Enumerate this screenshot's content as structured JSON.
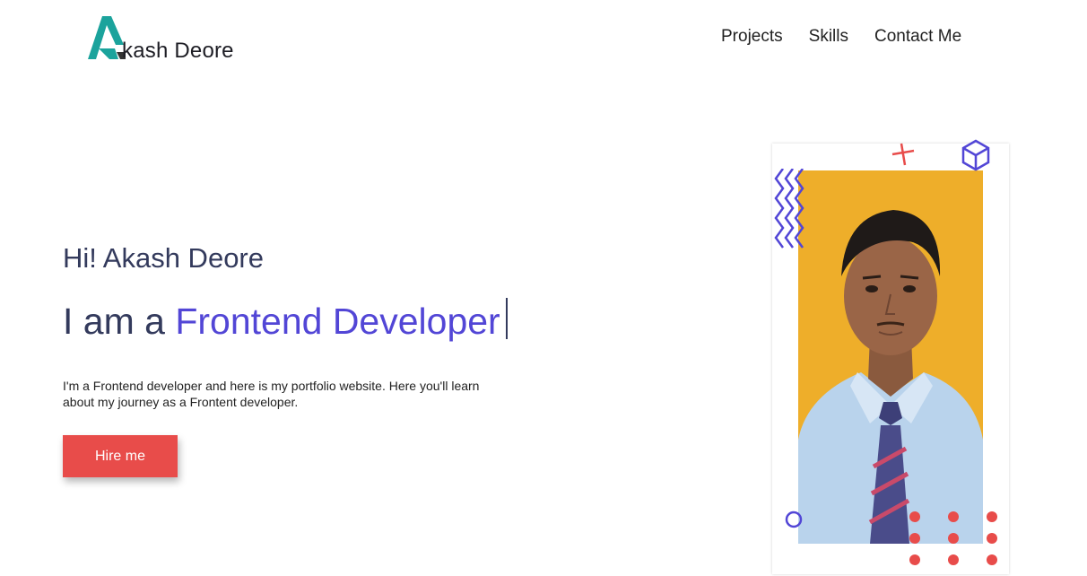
{
  "header": {
    "logo_text": "kash Deore",
    "logo_mark_letter": "A",
    "nav": [
      {
        "label": "Projects"
      },
      {
        "label": "Skills"
      },
      {
        "label": "Contact Me"
      }
    ]
  },
  "hero": {
    "greeting": "Hi! Akash Deore",
    "headline_prefix": "I am a ",
    "headline_role": "Frontend Developer",
    "intro": "I'm a Frontend developer and here is my portfolio website. Here you'll learn about my journey as a Frontent developer.",
    "cta_label": "Hire me"
  },
  "photo": {
    "icons": [
      "zigzag-icon",
      "plus-icon",
      "cube-icon",
      "circle-icon",
      "dots-grid-icon"
    ]
  },
  "colors": {
    "brand_teal": "#1ba39c",
    "accent_purple": "#5246d6",
    "button_red": "#e84c4a",
    "photo_bg": "#eeae2a",
    "heading_text": "#333a5c"
  }
}
